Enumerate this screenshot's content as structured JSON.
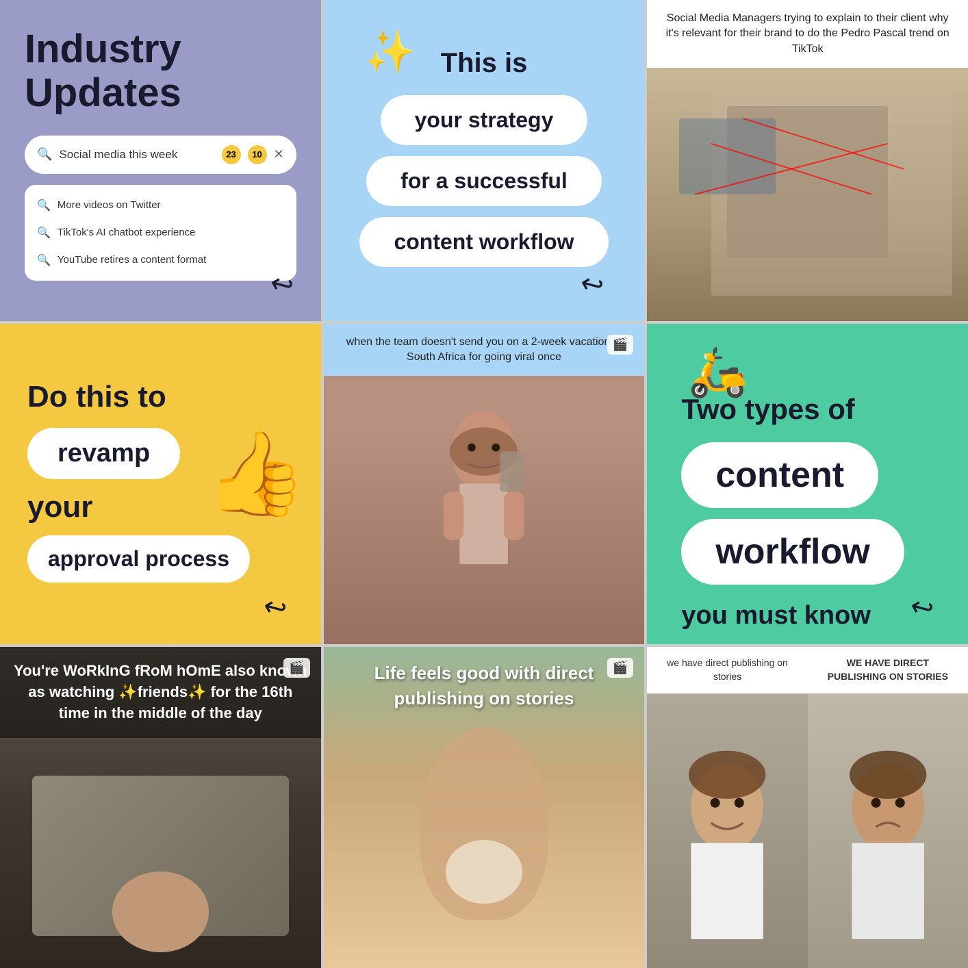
{
  "grid": {
    "cells": [
      {
        "id": "cell-1",
        "type": "industry-updates",
        "title": "Industry Updates",
        "search": {
          "placeholder": "Social media this week",
          "results": [
            "More videos on Twitter",
            "TikTok's AI chatbot experience",
            "YouTube retires a content format"
          ]
        },
        "badge": "23",
        "badge2": "10",
        "hasArrow": true
      },
      {
        "id": "cell-2",
        "type": "strategy",
        "intro": "This is",
        "pills": [
          "your strategy",
          "for a successful",
          "content workflow"
        ],
        "hasArrow": true
      },
      {
        "id": "cell-3",
        "type": "meme-charlie",
        "caption": "Social Media Managers trying to explain to their client why it's relevant for their brand to do the Pedro Pascal trend on TikTok"
      },
      {
        "id": "cell-4",
        "type": "revamp",
        "doThis": "Do this to",
        "pills": [
          "revamp",
          "approval process"
        ],
        "yourText": "your",
        "hasArrow": true
      },
      {
        "id": "cell-5",
        "type": "meme-phone",
        "caption": "when the team doesn't send you on a 2-week vacation in South Africa for going viral once"
      },
      {
        "id": "cell-6",
        "type": "two-types",
        "twoTypes": "Two types of",
        "pills": [
          "content",
          "workflow"
        ],
        "youMust": "you must know",
        "hasArrow": true
      },
      {
        "id": "cell-7",
        "type": "wfh-video",
        "caption": "You're WoRkInG fRoM hOmE also known as watching ✨friends✨ for the 16th time in the middle of the day"
      },
      {
        "id": "cell-8",
        "type": "life-feels-good",
        "caption": "Life feels good with direct publishing on stories"
      },
      {
        "id": "cell-9",
        "type": "direct-publishing",
        "captionLeft": "we have direct publishing on stories",
        "captionRight": "WE HAVE DIRECT PUBLISHING ON STORIES"
      }
    ]
  }
}
